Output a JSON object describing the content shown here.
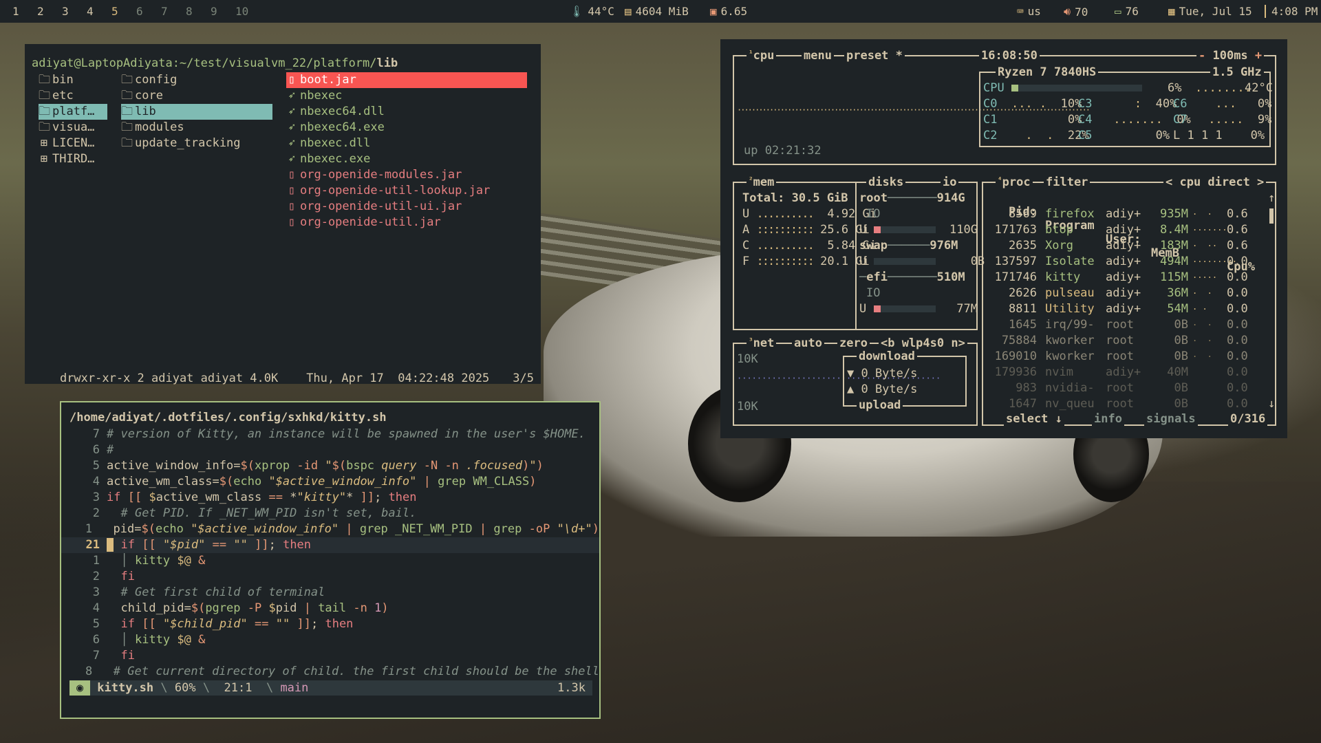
{
  "topbar": {
    "workspaces": [
      "1",
      "2",
      "3",
      "4",
      "5",
      "6",
      "7",
      "8",
      "9",
      "10"
    ],
    "active_workspace": "5",
    "temp": "44°C",
    "mem": "4604 MiB",
    "load": "6.65",
    "kbd": "us",
    "volume": "70",
    "battery": "76",
    "date": "Tue, Jul 15",
    "time": "4:08 PM"
  },
  "file_manager": {
    "path_prefix": "adiyat@LaptopAdiyata:~/test/visualvm_22/platform/",
    "path_current": "lib",
    "parent_items": [
      "bin",
      "etc",
      "platf…",
      "visua…",
      "LICEN…",
      "THIRD…"
    ],
    "current_items": [
      "config",
      "core",
      "lib",
      "modules",
      "update_tracking"
    ],
    "preview_items": [
      "boot.jar",
      "nbexec",
      "nbexec64.dll",
      "nbexec64.exe",
      "nbexec.dll",
      "nbexec.exe",
      "org-openide-modules.jar",
      "org-openide-util-lookup.jar",
      "org-openide-util-ui.jar",
      "org-openide-util.jar"
    ],
    "status_perm": "drwxr-xr-x 2 adiyat adiyat 4.0K",
    "status_date": "Thu, Apr 17  04:22:48 2025",
    "status_pos": "3/5"
  },
  "editor": {
    "file_path": "/home/adiyat/.dotfiles/.config/sxhkd/kitty.sh",
    "line_numbers": [
      "7",
      "6",
      "5",
      "4",
      "3",
      "2",
      "1",
      "21",
      "1",
      "2",
      "3",
      "4",
      "5",
      "6",
      "7",
      "8"
    ],
    "status_file": "kitty.sh",
    "status_percent": "60%",
    "status_pos": "21:1",
    "status_branch": "main",
    "status_size": "1.3k"
  },
  "btop": {
    "cpu_tabs": {
      "num": "¹",
      "cpu": "cpu",
      "menu": "menu",
      "preset": "preset *"
    },
    "clock": "16:08:50",
    "interval": "100ms",
    "cpu_model": "Ryzen 7 7840HS",
    "cpu_freq": "1.5 GHz",
    "cpu_total_label": "CPU",
    "cpu_total_pct": "6%",
    "cpu_temp": "42°C",
    "cores": [
      {
        "name": "C0",
        "pct": "10%"
      },
      {
        "name": "C3",
        "pct": "40%"
      },
      {
        "name": "C6",
        "pct": "0%"
      },
      {
        "name": "C1",
        "pct": "0%"
      },
      {
        "name": "C4",
        "pct": "0%"
      },
      {
        "name": "C7",
        "pct": "9%"
      },
      {
        "name": "C2",
        "pct": "22%"
      },
      {
        "name": "C5",
        "pct": "0%"
      }
    ],
    "load_avg": "L 1 1 1",
    "load_avg_pct": "0%",
    "uptime": "up 02:21:32",
    "mem": {
      "label": "mem",
      "total": "Total: 30.5 GiB",
      "rows": [
        {
          "k": "U",
          "v": "4.92 Gi"
        },
        {
          "k": "A",
          "v": "25.6 Gi"
        },
        {
          "k": "C",
          "v": "5.84 Gi"
        },
        {
          "k": "F",
          "v": "20.1 Gi"
        }
      ]
    },
    "disks": {
      "label": "disks",
      "io": "io",
      "root": "root",
      "root_size": "914G",
      "io1": "IO",
      "u1": "U",
      "u1_val": "110G",
      "swap": "swap",
      "swap_size": "976M",
      "u2": "U",
      "u2_val": "0B",
      "efi": "efi",
      "efi_size": "510M",
      "io2": "IO",
      "u3": "U",
      "u3_val": "77M"
    },
    "net": {
      "label": "net",
      "auto": "auto",
      "zero": "zero",
      "iface": "<b wlp4s0 n>",
      "top_scale": "10K",
      "bottom_scale": "10K",
      "download": "download",
      "down_rate": "▼ 0 Byte/s",
      "up_rate": "▲ 0 Byte/s",
      "upload": "upload"
    },
    "proc": {
      "label": "proc",
      "filter": "filter",
      "sort": "< cpu direct >",
      "headers": [
        "Pid:",
        "Program",
        "User:",
        "MemB",
        "Cpu%"
      ],
      "rows": [
        [
          "8569",
          "firefox",
          "adiy+",
          "935M",
          "0.6"
        ],
        [
          "171763",
          "btop",
          "adiy+",
          "8.4M",
          "0.6"
        ],
        [
          "2635",
          "Xorg",
          "adiy+",
          "183M",
          "0.6"
        ],
        [
          "137597",
          "Isolate",
          "adiy+",
          "494M",
          "0.0"
        ],
        [
          "171746",
          "kitty",
          "adiy+",
          "115M",
          "0.0"
        ],
        [
          "2626",
          "pulseau",
          "adiy+",
          "36M",
          "0.0"
        ],
        [
          "8811",
          "Utility",
          "adiy+",
          "54M",
          "0.0"
        ],
        [
          "1645",
          "irq/99-",
          "root",
          "0B",
          "0.0"
        ],
        [
          "75884",
          "kworker",
          "root",
          "0B",
          "0.0"
        ],
        [
          "169010",
          "kworker",
          "root",
          "0B",
          "0.0"
        ],
        [
          "179936",
          "nvim",
          "adiy+",
          "40M",
          "0.0"
        ],
        [
          "983",
          "nvidia-",
          "root",
          "0B",
          "0.0"
        ],
        [
          "1647",
          "nv_queu",
          "root",
          "0B",
          "0.0"
        ]
      ],
      "select": "select ↓",
      "info": "info",
      "signals": "signals",
      "count": "0/316"
    }
  }
}
